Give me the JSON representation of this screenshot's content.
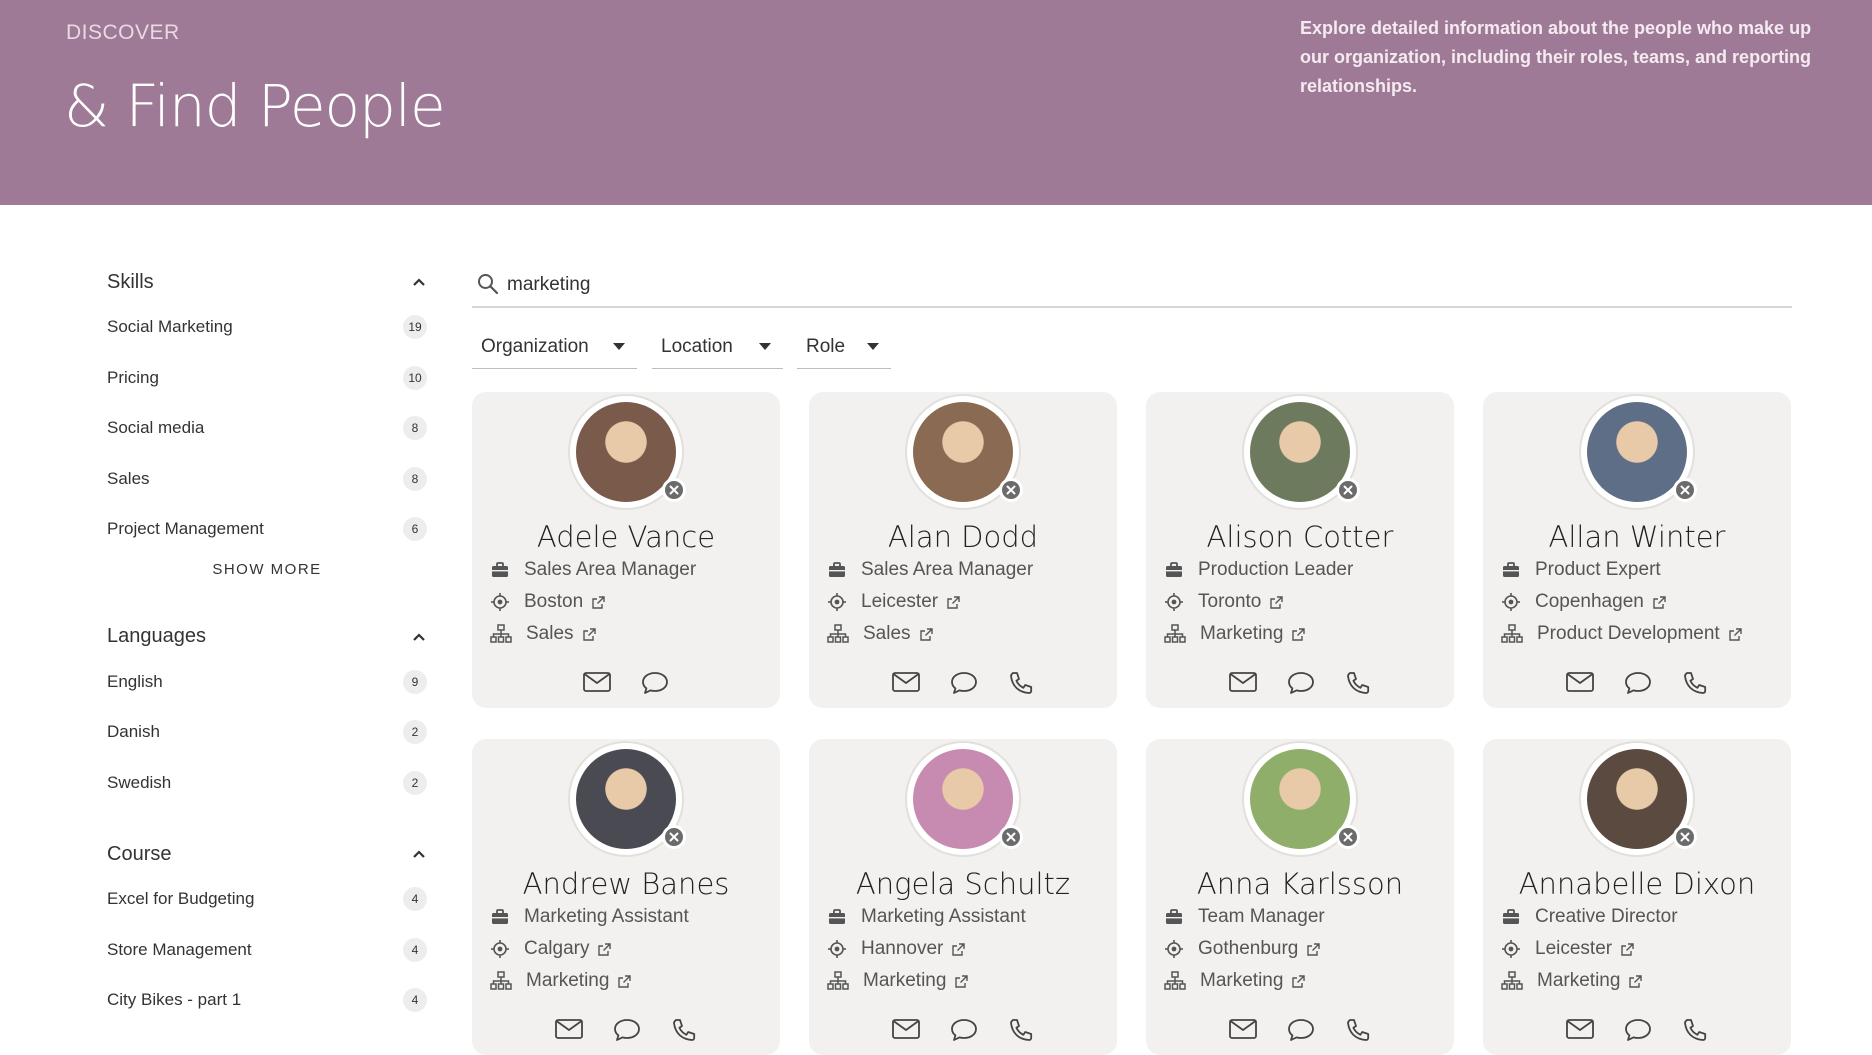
{
  "header": {
    "eyebrow": "DISCOVER",
    "title": "& Find People",
    "description": "Explore detailed information about the people who make up our organization, including their roles, teams, and reporting relationships.",
    "background": "#9e7a96"
  },
  "sidebar": {
    "groups": [
      {
        "title": "Skills",
        "items": [
          {
            "label": "Social Marketing",
            "count": "19"
          },
          {
            "label": "Pricing",
            "count": "10"
          },
          {
            "label": "Social media",
            "count": "8"
          },
          {
            "label": "Sales",
            "count": "8"
          },
          {
            "label": "Project Management",
            "count": "6"
          }
        ],
        "show_more": "SHOW MORE"
      },
      {
        "title": "Languages",
        "items": [
          {
            "label": "English",
            "count": "9"
          },
          {
            "label": "Danish",
            "count": "2"
          },
          {
            "label": "Swedish",
            "count": "2"
          }
        ]
      },
      {
        "title": "Course",
        "items": [
          {
            "label": "Excel for Budgeting",
            "count": "4"
          },
          {
            "label": "Store Management",
            "count": "4"
          },
          {
            "label": "City Bikes - part 1",
            "count": "4"
          }
        ]
      }
    ]
  },
  "search": {
    "value": "marketing",
    "icon": "search-icon"
  },
  "filters": [
    "Organization",
    "Location",
    "Role"
  ],
  "people": [
    {
      "name": "Adele Vance",
      "title": "Sales Area Manager",
      "location": "Boston",
      "department": "Sales",
      "phone": false,
      "color": "#7a5a4a"
    },
    {
      "name": "Alan Dodd",
      "title": "Sales Area Manager",
      "location": "Leicester",
      "department": "Sales",
      "phone": true,
      "color": "#8a6a52"
    },
    {
      "name": "Alison Cotter",
      "title": "Production Leader",
      "location": "Toronto",
      "department": "Marketing",
      "phone": true,
      "color": "#6e7a5e"
    },
    {
      "name": "Allan Winter",
      "title": "Product Expert",
      "location": "Copenhagen",
      "department": "Product Development",
      "phone": true,
      "color": "#5e6e86"
    },
    {
      "name": "Andrew Banes",
      "title": "Marketing Assistant",
      "location": "Calgary",
      "department": "Marketing",
      "phone": true,
      "color": "#4a4a52"
    },
    {
      "name": "Angela Schultz",
      "title": "Marketing Assistant",
      "location": "Hannover",
      "department": "Marketing",
      "phone": true,
      "color": "#c78ab0"
    },
    {
      "name": "Anna Karlsson",
      "title": "Team Manager",
      "location": "Gothenburg",
      "department": "Marketing",
      "phone": true,
      "color": "#8fae6a"
    },
    {
      "name": "Annabelle Dixon",
      "title": "Creative Director",
      "location": "Leicester",
      "department": "Marketing",
      "phone": true,
      "color": "#5a4a40"
    }
  ]
}
